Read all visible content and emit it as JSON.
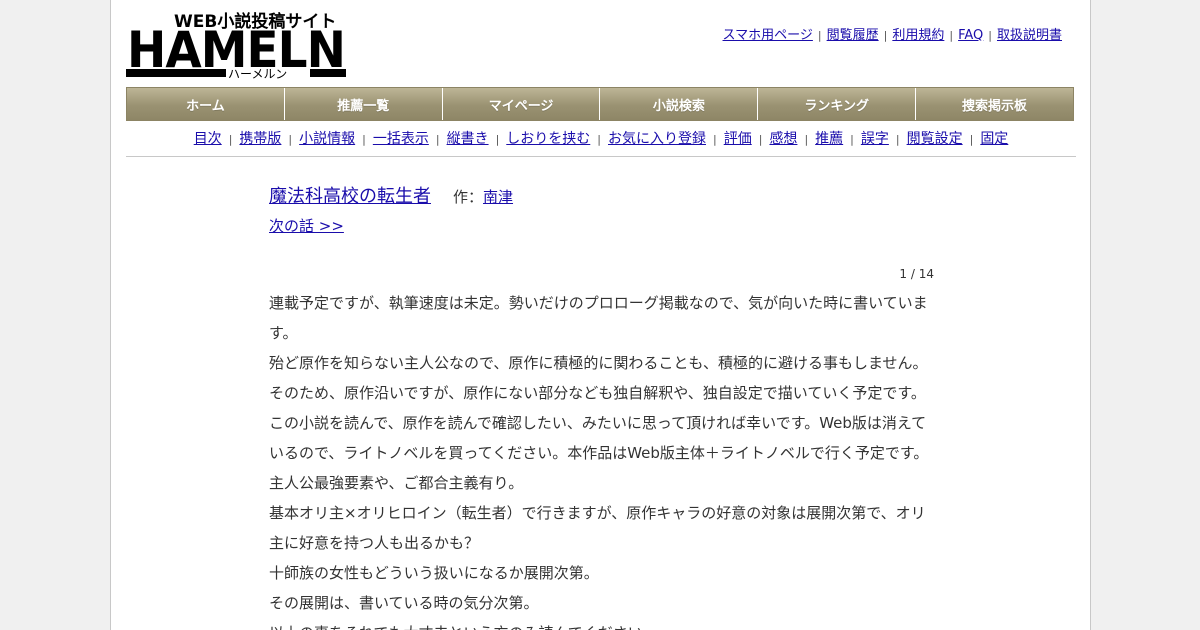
{
  "logo": {
    "main_text": "HAMELN",
    "tagline": "WEB小説投稿サイト",
    "katakana": "ハーメルン"
  },
  "top_links": [
    "スマホ用ページ",
    "閲覧履歴",
    "利用規約",
    "FAQ",
    "取扱説明書"
  ],
  "main_nav": [
    "ホーム",
    "推薦一覧",
    "マイページ",
    "小説検索",
    "ランキング",
    "捜索掲示板"
  ],
  "sub_nav": [
    "目次",
    "携帯版",
    "小説情報",
    "一括表示",
    "縦書き",
    "しおりを挟む",
    "お気に入り登録",
    "評価",
    "感想",
    "推薦",
    "誤字",
    "閲覧設定",
    "固定"
  ],
  "novel": {
    "title": "魔法科高校の転生者",
    "author_label": "作：",
    "author": "南津",
    "next_link": "次の話 >>",
    "page_count": "1 / 14"
  },
  "body_lines": [
    "連載予定ですが、執筆速度は未定。勢いだけのプロローグ掲載なので、気が向いた時に書いていま",
    "す。",
    "殆ど原作を知らない主人公なので、原作に積極的に関わることも、積極的に避ける事もしません。",
    "そのため、原作沿いですが、原作にない部分なども独自解釈や、独自設定で描いていく予定です。",
    "この小説を読んで、原作を読んで確認したい、みたいに思って頂ければ幸いです。Web版は消えて",
    "いるので、ライトノベルを買ってください。本作品はWeb版主体＋ライトノベルで行く予定です。",
    "主人公最強要素や、ご都合主義有り。",
    "基本オリ主×オリヒロイン（転生者）で行きますが、原作キャラの好意の対象は展開次第で、オリ",
    "主に好意を持つ人も出るかも？",
    "十師族の女性もどういう扱いになるか展開次第。",
    "その展開は、書いている時の気分次第。",
    "以上の事をそれでも大丈夫という方のみ読んでください。"
  ],
  "colors": {
    "link": "#1a0dab",
    "nav_bg": "#9a9272",
    "page_bg": "#f0f0f0"
  }
}
